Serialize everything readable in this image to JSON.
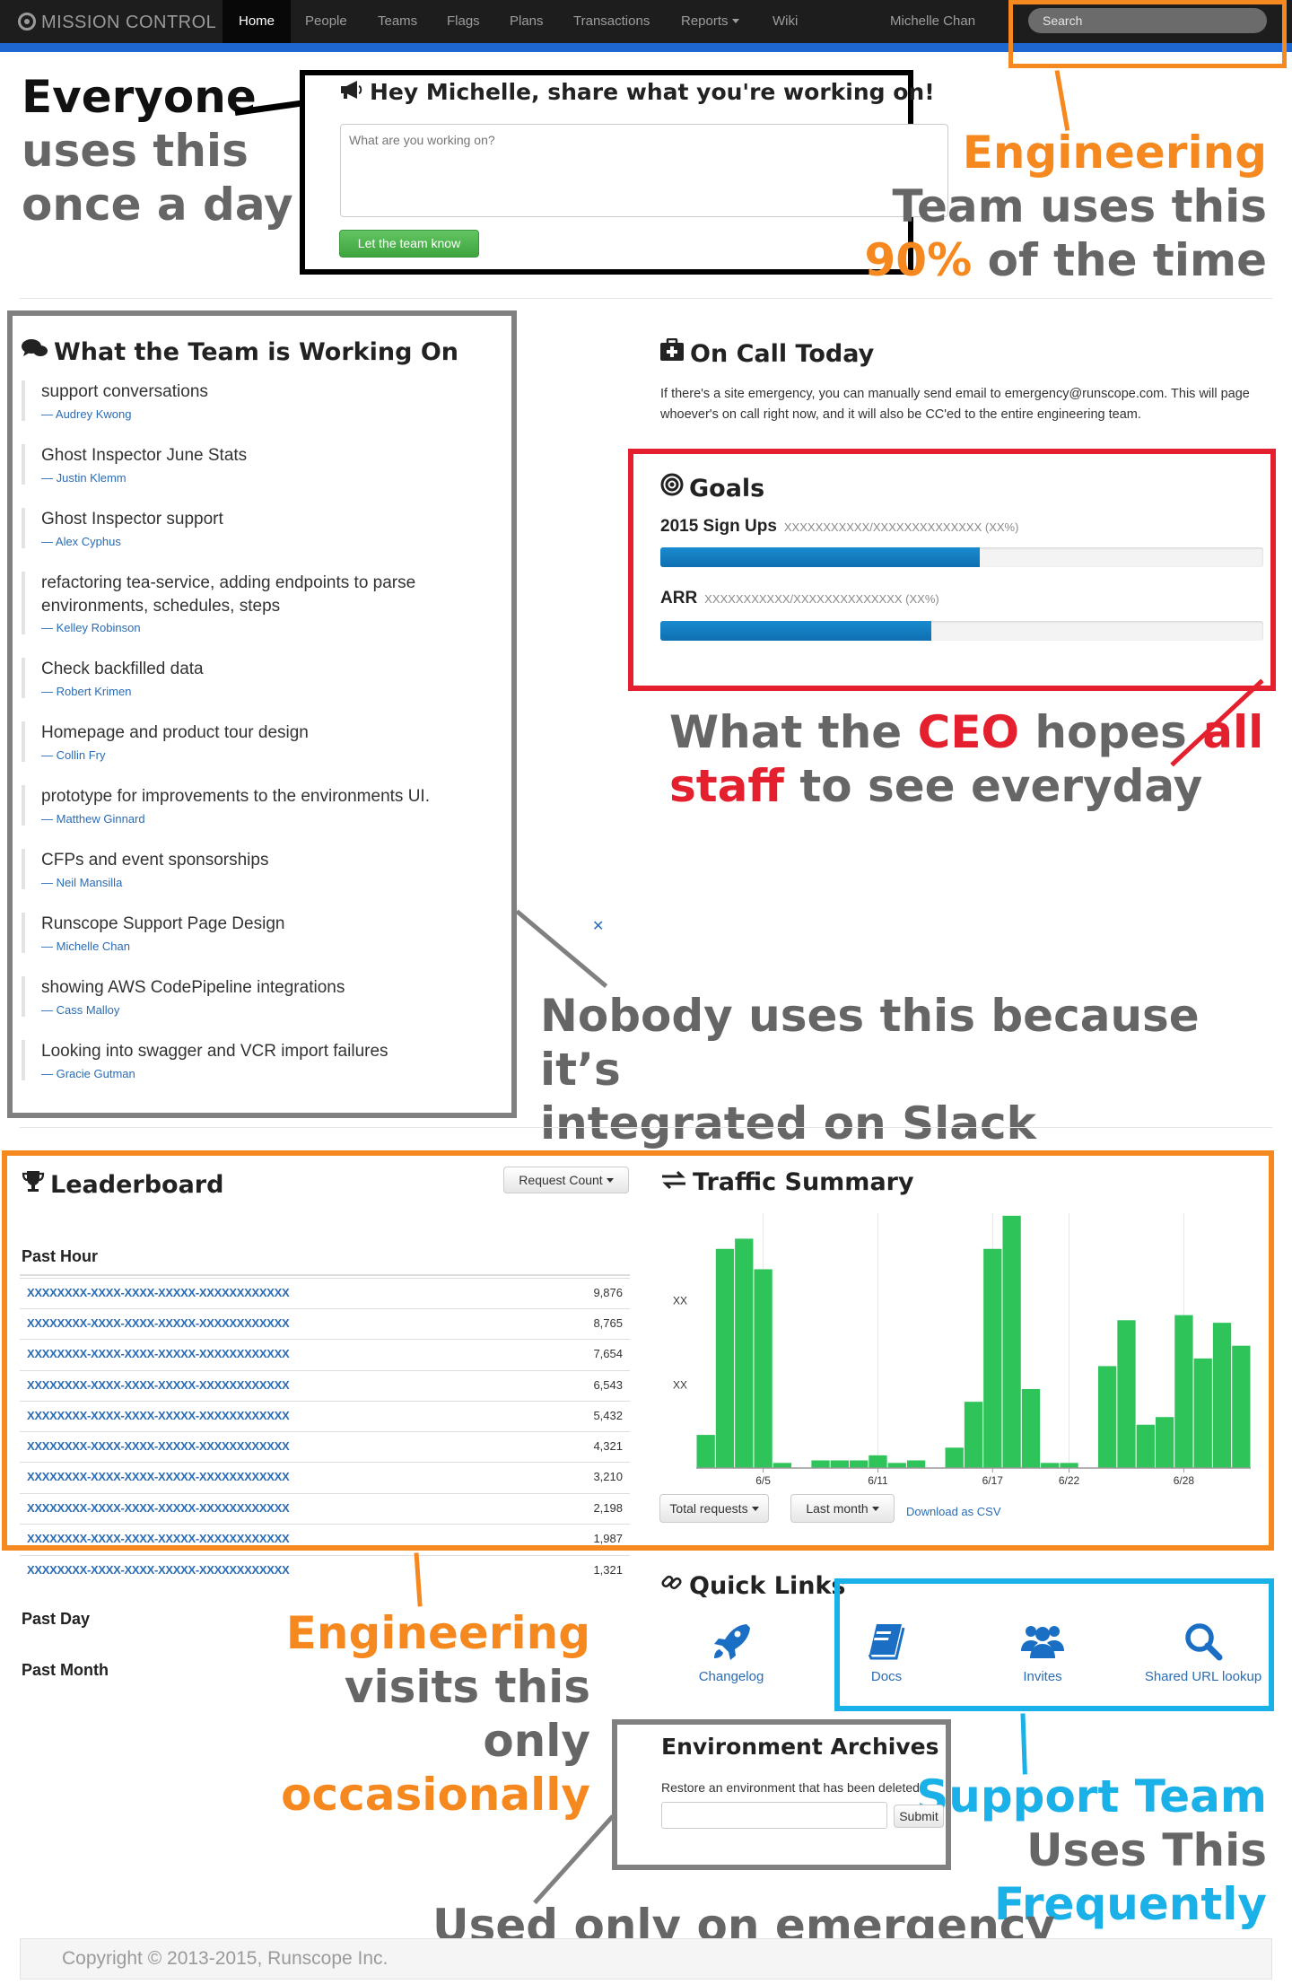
{
  "nav": {
    "brand": "MISSION CONTROL",
    "items": [
      "Home",
      "People",
      "Teams",
      "Flags",
      "Plans",
      "Transactions",
      "Reports",
      "Wiki"
    ],
    "user": "Michelle Chan",
    "search_placeholder": "Search"
  },
  "status_box": {
    "title": "Hey Michelle, share what you're working on!",
    "placeholder": "What are you working on?",
    "submit_label": "Let the team know"
  },
  "working_on": {
    "title": "What the Team is Working On",
    "items": [
      {
        "text": "support conversations",
        "author": "— Audrey Kwong"
      },
      {
        "text": "Ghost Inspector June Stats",
        "author": "— Justin Klemm"
      },
      {
        "text": "Ghost Inspector support",
        "author": "— Alex Cyphus"
      },
      {
        "text": "refactoring tea-service, adding endpoints to parse environments, schedules, steps",
        "author": "— Kelley Robinson"
      },
      {
        "text": "Check backfilled data",
        "author": "— Robert Krimen"
      },
      {
        "text": "Homepage and product tour design",
        "author": "— Collin Fry"
      },
      {
        "text": "prototype for improvements to the environments UI.",
        "author": "— Matthew Ginnard"
      },
      {
        "text": "CFPs and event sponsorships",
        "author": "— Neil Mansilla"
      },
      {
        "text": "Runscope Support Page Design",
        "author": "— Michelle Chan"
      },
      {
        "text": "showing AWS CodePipeline integrations",
        "author": "— Cass Malloy"
      },
      {
        "text": "Looking into swagger and VCR import failures",
        "author": "— Gracie Gutman"
      }
    ]
  },
  "on_call": {
    "title": "On Call Today",
    "body": "If there's a site emergency, you can manually send email to emergency@runscope.com. This will page whoever's on call right now, and it will also be CC'ed to the entire engineering team."
  },
  "goals": {
    "title": "Goals",
    "items": [
      {
        "label": "2015 Sign Ups",
        "detail": "XXXXXXXXXXX/XXXXXXXXXXXXXX (XX%)",
        "progress": 0.53
      },
      {
        "label": "ARR",
        "detail": "XXXXXXXXXXX/XXXXXXXXXXXXXX (XX%)",
        "progress": 0.45
      }
    ]
  },
  "leaderboard": {
    "title": "Leaderboard",
    "dropdown": "Request Count",
    "past_hour": "Past Hour",
    "rows": [
      {
        "key": "XXXXXXXX-XXXX-XXXX-XXXXX-XXXXXXXXXXXX",
        "value": "9,876"
      },
      {
        "key": "XXXXXXXX-XXXX-XXXX-XXXXX-XXXXXXXXXXXX",
        "value": "8,765"
      },
      {
        "key": "XXXXXXXX-XXXX-XXXX-XXXXX-XXXXXXXXXXXX",
        "value": "7,654"
      },
      {
        "key": "XXXXXXXX-XXXX-XXXX-XXXXX-XXXXXXXXXXXX",
        "value": "6,543"
      },
      {
        "key": "XXXXXXXX-XXXX-XXXX-XXXXX-XXXXXXXXXXXX",
        "value": "5,432"
      },
      {
        "key": "XXXXXXXX-XXXX-XXXX-XXXXX-XXXXXXXXXXXX",
        "value": "4,321"
      },
      {
        "key": "XXXXXXXX-XXXX-XXXX-XXXXX-XXXXXXXXXXXX",
        "value": "3,210"
      },
      {
        "key": "XXXXXXXX-XXXX-XXXX-XXXXX-XXXXXXXXXXXX",
        "value": "2,198"
      },
      {
        "key": "XXXXXXXX-XXXX-XXXX-XXXXX-XXXXXXXXXXXX",
        "value": "1,987"
      },
      {
        "key": "XXXXXXXX-XXXX-XXXX-XXXXX-XXXXXXXXXXXX",
        "value": "1,321"
      }
    ],
    "past_day": "Past Day",
    "past_month": "Past Month"
  },
  "traffic": {
    "title": "Traffic Summary",
    "total_btn": "Total requests",
    "range_btn": "Last month",
    "csv_link": "Download as CSV"
  },
  "chart_data": {
    "type": "bar",
    "title": "Traffic Summary",
    "x_tick_labels": [
      "6/5",
      "6/11",
      "6/17",
      "6/22",
      "6/28"
    ],
    "y_tick_labels": [
      "XX",
      "XX"
    ],
    "ylim": [
      0,
      100
    ],
    "grid": true,
    "color": "#2fc45a",
    "values": [
      13,
      86,
      90,
      78,
      2,
      0,
      3,
      3,
      3,
      5,
      2,
      3,
      0,
      8,
      26,
      86,
      99,
      31,
      2,
      2,
      0,
      40,
      58,
      17,
      20,
      60,
      43,
      57,
      48
    ]
  },
  "quick_links": {
    "title": "Quick Links",
    "items": [
      {
        "label": "Changelog",
        "icon": "rocket-icon"
      },
      {
        "label": "Docs",
        "icon": "book-icon"
      },
      {
        "label": "Invites",
        "icon": "users-icon"
      },
      {
        "label": "Shared URL lookup",
        "icon": "search-icon"
      }
    ]
  },
  "env_archives": {
    "title": "Environment Archives",
    "body": "Restore an environment that has been deleted",
    "submit": "Submit"
  },
  "footer": {
    "copyright": "Copyright © 2013-2015, Runscope Inc."
  },
  "annotations": {
    "everyone": [
      "Everyone",
      "uses this",
      "once a day"
    ],
    "engineering_top": {
      "l1": "Engineering",
      "l2": "Team uses this",
      "l3_accent": "90%",
      "l3_rest": " of the time"
    },
    "ceo": {
      "p1": "What the ",
      "p2": "CEO",
      "p3": " hopes ",
      "p4": "all",
      "p5": "staff",
      "p6": " to see everyday"
    },
    "nobody": [
      "Nobody uses this because it’s",
      "integrated on Slack"
    ],
    "engineering_bottom": [
      "Engineering",
      "visits this only",
      "occasionally"
    ],
    "support": [
      "Support Team",
      "Uses This",
      "Frequently"
    ],
    "emergency": "Used only on emergency"
  },
  "colors": {
    "orange": "#f5891f",
    "red": "#e5202e",
    "cyan": "#1ab0e8",
    "gray_box": "#808080",
    "nav_bg": "#1d1d1d",
    "nav_accent": "#1e66d0",
    "bar_green": "#2fc45a"
  }
}
